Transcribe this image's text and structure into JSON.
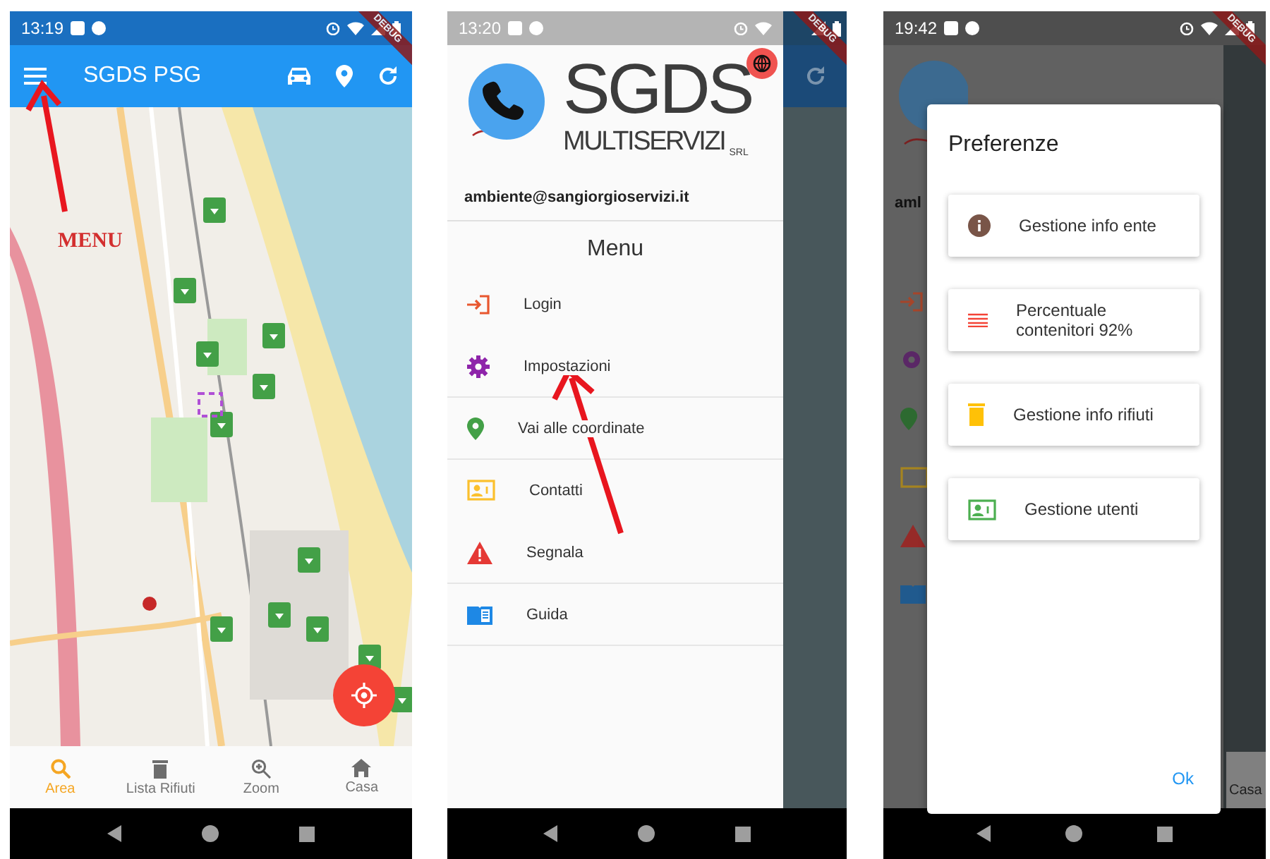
{
  "phones": [
    {
      "kind": "map",
      "status_bar": {
        "time": "13:19"
      },
      "debug_banner": "DEBUG",
      "app_bar": {
        "title": "SGDS PSG"
      },
      "annotation": "MENU",
      "bottom_nav": [
        {
          "label": "Area",
          "selected": true
        },
        {
          "label": "Lista Rifiuti",
          "selected": false
        },
        {
          "label": "Zoom",
          "selected": false
        },
        {
          "label": "Casa",
          "selected": false
        }
      ]
    },
    {
      "kind": "drawer",
      "status_bar": {
        "time": "13:20"
      },
      "debug_banner": "DEBUG",
      "drawer": {
        "logo": {
          "title": "SGDS",
          "subtitle": "MULTISERVIZI",
          "suffix": "SRL"
        },
        "email": "ambiente@sangiorgioservizi.it",
        "heading": "Menu",
        "items": [
          {
            "label": "Login",
            "divider": false
          },
          {
            "label": "Impostazioni",
            "divider": true
          },
          {
            "label": "Vai alle coordinate",
            "divider": true
          },
          {
            "label": "Contatti",
            "divider": false
          },
          {
            "label": "Segnala",
            "divider": true
          },
          {
            "label": "Guida",
            "divider": true
          }
        ]
      }
    },
    {
      "kind": "dialog",
      "status_bar": {
        "time": "19:42"
      },
      "debug_banner": "DEBUG",
      "behind": {
        "email_fragment": "aml",
        "nav_label": "Casa"
      },
      "dialog": {
        "title": "Preferenze",
        "options": [
          {
            "label": "Gestione info ente"
          },
          {
            "label": "Percentuale contenitori 92%"
          },
          {
            "label": "Gestione info rifiuti"
          },
          {
            "label": "Gestione utenti"
          }
        ],
        "button": "Ok"
      }
    }
  ]
}
